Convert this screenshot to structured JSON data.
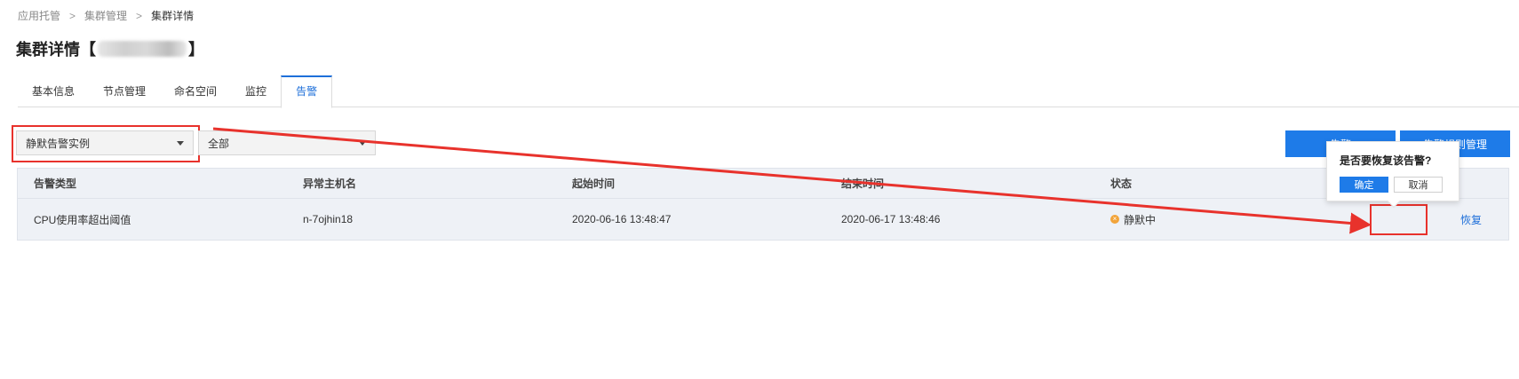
{
  "breadcrumb": {
    "items": [
      "应用托管",
      "集群管理",
      "集群详情"
    ],
    "separator": ">"
  },
  "page": {
    "title_prefix": "集群详情【",
    "title_suffix": "】"
  },
  "tabs": [
    "基本信息",
    "节点管理",
    "命名空间",
    "监控",
    "告警"
  ],
  "active_tab": "告警",
  "filters": {
    "instance_type": "静默告警实例",
    "scope": "全部"
  },
  "toolbar": {
    "button_a": "告警",
    "button_b": "告警规则管理"
  },
  "table": {
    "headers": [
      "告警类型",
      "异常主机名",
      "起始时间",
      "结束时间",
      "状态",
      ""
    ],
    "rows": [
      {
        "type": "CPU使用率超出阈值",
        "host": "n-7ojhin18",
        "start": "2020-06-16 13:48:47",
        "end": "2020-06-17 13:48:46",
        "status": "静默中",
        "action": "恢复"
      }
    ]
  },
  "popover": {
    "title": "是否要恢复该告警?",
    "ok": "确定",
    "cancel": "取消"
  },
  "colors": {
    "primary": "#1e7be8",
    "annotation_red": "#e8322c",
    "status_silenced": "#f2a43a"
  }
}
